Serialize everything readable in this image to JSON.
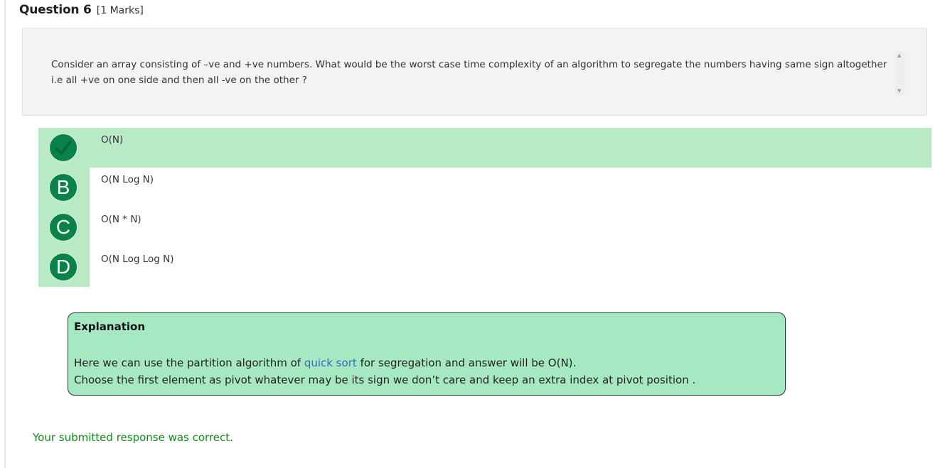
{
  "question": {
    "title": "Question 6",
    "marks": "[1 Marks]",
    "text": "Consider an array consisting of –ve and +ve numbers. What would be the worst case time complexity of an algorithm to segregate the numbers having same sign altogether i.e all +ve on one side and then all -ve on the other ?"
  },
  "options": [
    {
      "badge": "",
      "icon": "checkmark-icon",
      "text": "O(N)",
      "state": "correct"
    },
    {
      "badge": "B",
      "text": "O(N Log N)"
    },
    {
      "badge": "C",
      "text": "O(N * N)"
    },
    {
      "badge": "D",
      "text": "O(N Log Log N)"
    }
  ],
  "explanation": {
    "title": "Explanation",
    "line1_before": "Here we can use the partition algorithm of ",
    "line1_link": "quick sort",
    "line1_after": " for segregation and answer will be O(N).",
    "line2": "Choose the first element as pivot whatever may be its sign we don’t care and keep an extra index at pivot position ."
  },
  "result_message": "Your submitted response was correct.",
  "colors": {
    "correct_bg": "#b8eac6",
    "badge_green": "#09824a",
    "explanation_bg": "#a6e8c2",
    "link": "#2f6fc0",
    "success_text": "#138a1a"
  }
}
